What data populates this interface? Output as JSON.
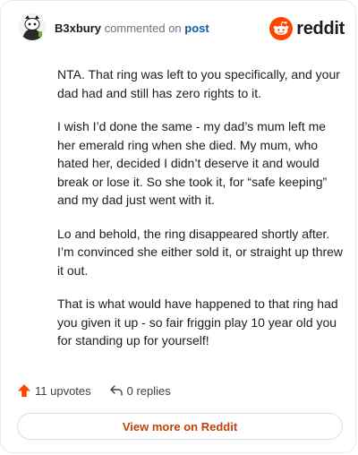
{
  "header": {
    "username": "B3xbury",
    "action_text": "commented on",
    "link_text": "post",
    "brand": "reddit"
  },
  "comment": {
    "paragraphs": [
      "NTA. That ring was left to you specifically, and your dad had and still has zero rights to it.",
      "I wish I’d done the same - my dad’s mum left me her emerald ring when she died. My mum, who hated her, decided I didn’t deserve it and would break or lose it. So she took it, for “safe keeping” and my dad just went with it.",
      "Lo and behold, the ring disappeared shortly after. I’m convinced she either sold it, or straight up threw it out.",
      "That is what would have happened to that ring had you given it up - so fair friggin play 10 year old you for standing up for yourself!"
    ]
  },
  "actions": {
    "upvotes": "11 upvotes",
    "replies": "0 replies"
  },
  "footer": {
    "view_more": "View more on Reddit"
  },
  "colors": {
    "accent": "#ff4500",
    "link": "#0b5fa5",
    "view_more": "#c2410c"
  }
}
